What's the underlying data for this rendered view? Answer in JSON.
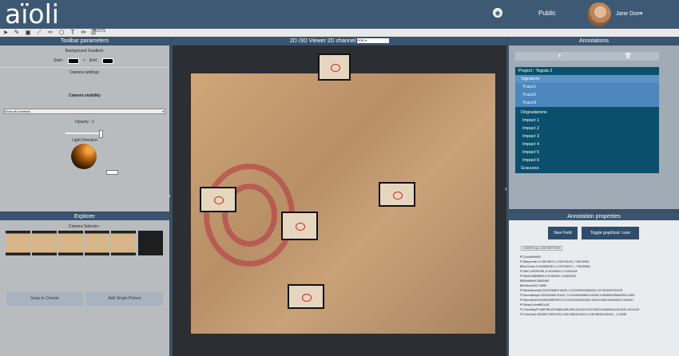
{
  "header": {
    "logo": "aïoli",
    "visibility": "Public",
    "user": "Jane Doe▾"
  },
  "toolbar": {
    "tests_label": "TESTS"
  },
  "left_panel": {
    "title": "Toolbar parameters",
    "background_gradient": "Background Gradient:",
    "start": "Start :",
    "end_sep": ">",
    "end": "End :",
    "camera_settings": "Camera settings:",
    "camera_visibility": "Camera visibility",
    "camera_select": "Show all cameras",
    "opacity": "Opacity : 1",
    "opacity_value": 1,
    "light_direction": "Light Direction"
  },
  "explorer": {
    "title": "Explorer",
    "camera_selector": "Camera Selector :",
    "snap_button": "Snap to Closest",
    "add_button": "Add Single Picture"
  },
  "viewer": {
    "title": "2D /3D Viewer 2D channel",
    "channel_value": "RGB"
  },
  "annotations": {
    "title": "Annotations",
    "add_icon": "plus-icon",
    "delete_icon": "trash-icon",
    "items": [
      {
        "label": "Project : Tegula 2"
      },
      {
        "label": "Signature"
      },
      {
        "label": "Trace1"
      },
      {
        "label": "Trace2"
      },
      {
        "label": "Trace3"
      },
      {
        "label": "Dégradations"
      },
      {
        "label": "Impact 1"
      },
      {
        "label": "Impact 2"
      },
      {
        "label": "Impact 3"
      },
      {
        "label": "Impact 4"
      },
      {
        "label": "Impact 5"
      },
      {
        "label": "Impact 6"
      },
      {
        "label": "Gravures"
      }
    ]
  },
  "properties": {
    "title": "Annotation properties",
    "new_field": "New Field",
    "toggle": "Toggle graphical / user",
    "graphical_label": "GRAPHICAL DESCRIPTORS",
    "lines": [
      "PCCount506653",
      "PCBarycenter-0.136139673,-0.262234118,-7.65149954",
      "BBoxCenter-0.0363892343,-0.0157008171,-7.95490646",
      "PCMin-4.05796766,-6.34203616,-9.10332108",
      "PCMax3.98638899,6.31092453,-6.40649233",
      "BBWidthBx8.16652485",
      "BBVolume233.75885",
      "PCMeanNormal0.0315375689734625,-0.0120993013006242,0.873029267879478",
      "PCNormalMap0.0315020581761257,-0.0103950098941293262,0.899583078646395,0.4631",
      "PCNormalVar0.644500458978072,0.076124194231168,0.054414495740919535,0.0452817",
      "PCMeanColor#BEA181",
      "PCColorMapPC#B6785,#CFAB86,#EBC699,#C3AD7E,#ECE8E3,#AABA69,#312D2E,#1D1A1E",
      "PCColorVar0.250350175822478,0.184178816143412,0.155788331031615...,0.13639"
    ]
  },
  "colors": {
    "header": "#3e5974",
    "accent": "#5a93c7",
    "tree_bg": "#0a4f6c"
  }
}
